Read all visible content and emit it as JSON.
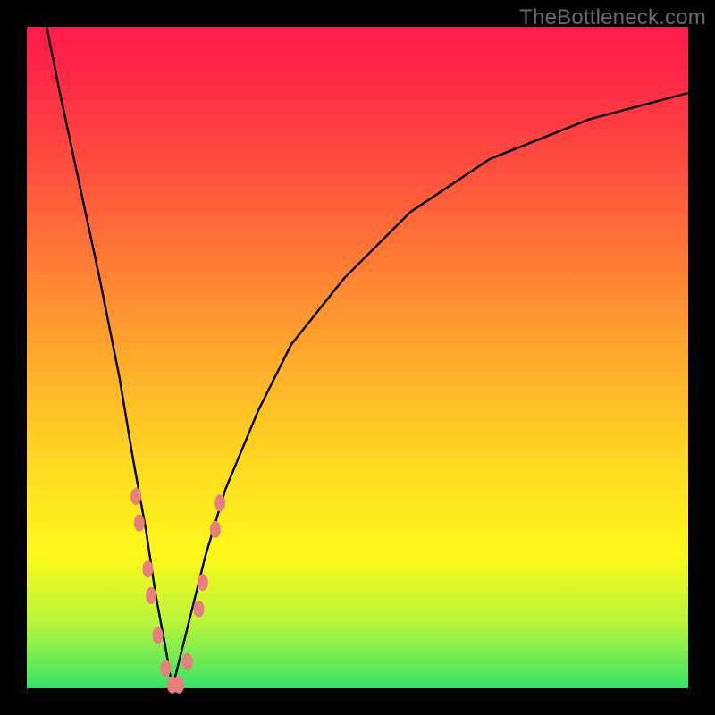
{
  "watermark": {
    "text": "TheBottleneck.com"
  },
  "gradient_colors": {
    "top": "#ff1a4b",
    "mid1": "#ff5a3c",
    "mid2": "#ffb928",
    "yellow": "#ffe31e",
    "green": "#37e36a"
  },
  "chart_data": {
    "type": "line",
    "title": "",
    "xlabel": "",
    "ylabel": "",
    "xlim": [
      0,
      100
    ],
    "ylim": [
      0,
      100
    ],
    "x_of_minimum": 22,
    "series": [
      {
        "name": "bottleneck-curve",
        "color": "#000000",
        "x": [
          3,
          5,
          8,
          11,
          14,
          16,
          18,
          19.5,
          21,
          22,
          23,
          24.5,
          27,
          30,
          35,
          40,
          48,
          58,
          70,
          85,
          100
        ],
        "y": [
          100,
          90,
          76,
          62,
          47,
          35,
          24,
          14,
          6,
          0,
          4,
          10,
          20,
          30,
          42,
          52,
          62,
          72,
          80,
          86,
          90
        ]
      }
    ],
    "markers": {
      "name": "pink-beads",
      "color": "#e77f7f",
      "radius_px": 7,
      "points": [
        {
          "x": 16.5,
          "y": 29
        },
        {
          "x": 17.0,
          "y": 25
        },
        {
          "x": 18.3,
          "y": 18
        },
        {
          "x": 18.8,
          "y": 14
        },
        {
          "x": 19.8,
          "y": 8
        },
        {
          "x": 21.0,
          "y": 3
        },
        {
          "x": 22.0,
          "y": 0.5
        },
        {
          "x": 23.0,
          "y": 0.5
        },
        {
          "x": 24.3,
          "y": 4
        },
        {
          "x": 26.0,
          "y": 12
        },
        {
          "x": 26.6,
          "y": 16
        },
        {
          "x": 28.5,
          "y": 24
        },
        {
          "x": 29.2,
          "y": 28
        }
      ]
    }
  }
}
